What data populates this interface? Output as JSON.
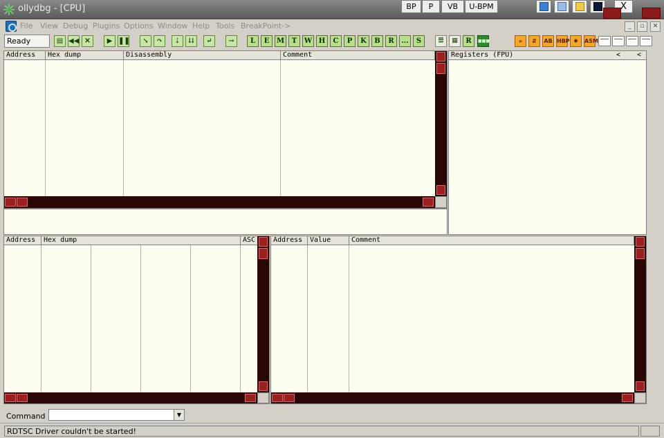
{
  "window": {
    "title": "ollydbg - [CPU]",
    "close": "X"
  },
  "title_buttons": [
    "BP",
    "P",
    "VB",
    "U-BPM"
  ],
  "menu": [
    "File",
    "View",
    "Debug",
    "Plugins",
    "Options",
    "Window",
    "Help",
    "Tools",
    "BreakPoint->"
  ],
  "toolbar": {
    "status": "Ready",
    "letters": [
      "L",
      "E",
      "M",
      "T",
      "W",
      "H",
      "C",
      "P",
      "K",
      "B",
      "R",
      "...",
      "S"
    ],
    "right_labels": [
      "HBP",
      "ASM"
    ]
  },
  "disasm_pane": {
    "headers": [
      "Address",
      "Hex dump",
      "Disassembly",
      "Comment"
    ]
  },
  "registers_pane": {
    "header": "Registers (FPU)",
    "arrows": [
      "<",
      "<"
    ]
  },
  "dump_pane": {
    "headers": [
      "Address",
      "Hex dump",
      "ASC"
    ]
  },
  "stack_pane": {
    "headers": [
      "Address",
      "Value",
      "Comment"
    ]
  },
  "command": {
    "label": "Command :",
    "value": ""
  },
  "statusbar": {
    "text": "RDTSC Driver couldn't be started!"
  },
  "colors": {
    "pane_bg": "#fffcf0",
    "scroll_bg": "#2a0606",
    "scroll_btn": "#9a2020",
    "toolbar_btn": "#c9e6a9"
  }
}
